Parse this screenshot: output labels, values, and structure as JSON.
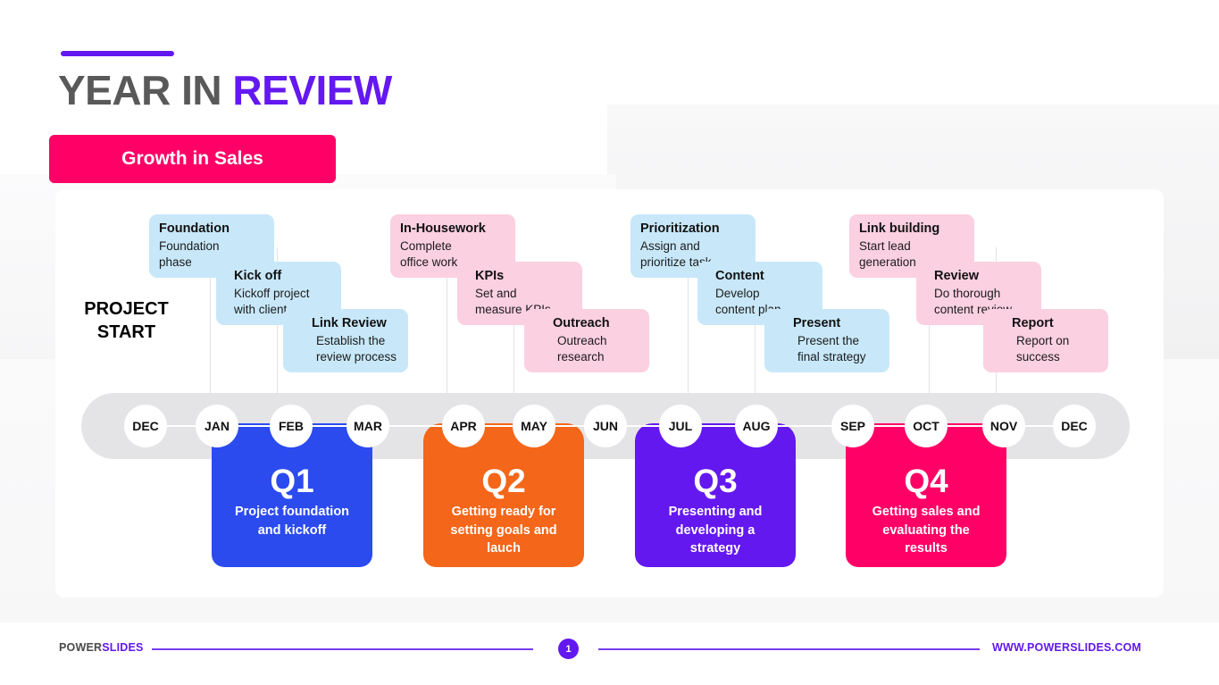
{
  "header": {
    "title_plain": "YEAR IN ",
    "title_highlight": "REVIEW",
    "accent_color": "#6418F0",
    "subtitle": "Growth in Sales",
    "subtitle_bg": "#FF0066"
  },
  "timeline": {
    "start_label_line1": "PROJECT",
    "start_label_line2": "START",
    "months": [
      "DEC",
      "JAN",
      "FEB",
      "MAR",
      "APR",
      "MAY",
      "JUN",
      "JUL",
      "AUG",
      "SEP",
      "OCT",
      "NOV",
      "DEC"
    ]
  },
  "milestones": [
    {
      "title": "Foundation",
      "desc": "Foundation\nphase",
      "color": "blue"
    },
    {
      "title": "Kick off",
      "desc": "Kickoff project\nwith client",
      "color": "blue"
    },
    {
      "title": "Link Review",
      "desc": "Establish the\nreview process",
      "color": "blue"
    },
    {
      "title": "In-Housework",
      "desc": "Complete\noffice work",
      "color": "pink"
    },
    {
      "title": "KPIs",
      "desc": "Set and\nmeasure KPIs",
      "color": "pink"
    },
    {
      "title": "Outreach",
      "desc": "Outreach\nresearch",
      "color": "pink"
    },
    {
      "title": "Prioritization",
      "desc": "Assign and\nprioritize task",
      "color": "blue"
    },
    {
      "title": "Content",
      "desc": "Develop\ncontent plan",
      "color": "blue"
    },
    {
      "title": "Present",
      "desc": "Present the\nfinal strategy",
      "color": "blue"
    },
    {
      "title": "Link building",
      "desc": "Start lead\ngeneration",
      "color": "pink"
    },
    {
      "title": "Review",
      "desc": "Do thorough\ncontent review",
      "color": "pink"
    },
    {
      "title": "Report",
      "desc": "Report on\nsuccess",
      "color": "pink"
    }
  ],
  "quarters": [
    {
      "label": "Q1",
      "desc": "Project foundation\nand kickoff",
      "color": "#2B4BEF"
    },
    {
      "label": "Q2",
      "desc": "Getting ready for\nsetting goals and\nlauch",
      "color": "#F46619"
    },
    {
      "label": "Q3",
      "desc": "Presenting and\ndeveloping a\nstrategy",
      "color": "#6418F0"
    },
    {
      "label": "Q4",
      "desc": "Getting sales and\nevaluating the\nresults",
      "color": "#FF0066"
    }
  ],
  "footer": {
    "logo_part1": "POWER",
    "logo_part2": "SLIDES",
    "page_number": "1",
    "url": "WWW.POWERSLIDES.COM",
    "line_color": "#6418F0"
  }
}
